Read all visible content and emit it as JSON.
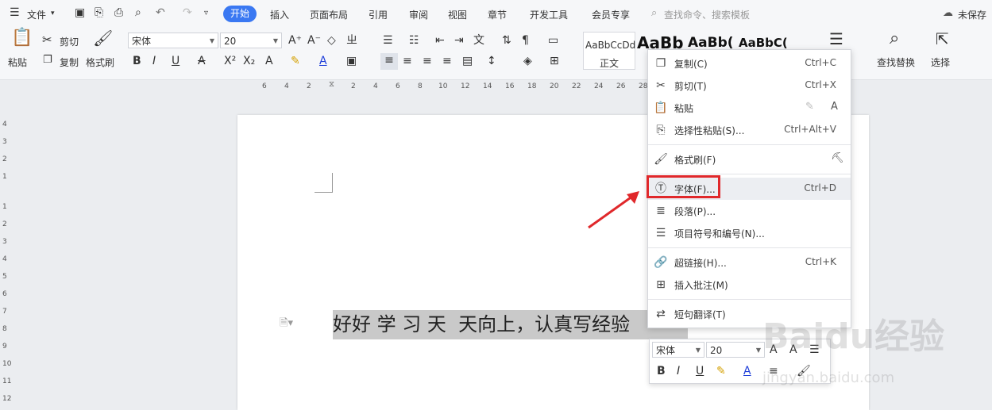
{
  "title_bar": {
    "file_menu": "文件",
    "tabs": [
      "开始",
      "插入",
      "页面布局",
      "引用",
      "审阅",
      "视图",
      "章节",
      "开发工具",
      "会员专享"
    ],
    "active_tab": "开始",
    "search_placeholder": "查找命令、搜索模板",
    "save_status": "未保存"
  },
  "ribbon": {
    "paste": "粘贴",
    "cut": "剪切",
    "copy": "复制",
    "format_painter": "格式刷",
    "font_name": "宋体",
    "font_size": "20",
    "styles": [
      "AaBbCcDd",
      "AaBb",
      "AaBb(",
      "AaBbC("
    ],
    "style_normal_label": "正文",
    "find_replace": "查找替换",
    "select": "选择",
    "accent_color": "#3a78f2"
  },
  "ruler": {
    "numbers": [
      "6",
      "4",
      "2",
      "2",
      "4",
      "6",
      "8",
      "10",
      "12",
      "14",
      "16",
      "18",
      "20",
      "22",
      "24",
      "26",
      "28"
    ],
    "vertical_numbers": [
      "4",
      "3",
      "2",
      "1",
      "1",
      "2",
      "3",
      "4",
      "5",
      "6",
      "7",
      "8",
      "9",
      "10",
      "11",
      "12"
    ]
  },
  "document": {
    "text": "好好 学 习 天  天向上，认真写经验"
  },
  "context_menu": {
    "items": [
      {
        "icon": "copy-icon",
        "label": "复制(C)",
        "shortcut": "Ctrl+C"
      },
      {
        "icon": "cut-icon",
        "label": "剪切(T)",
        "shortcut": "Ctrl+X"
      },
      {
        "icon": "paste-icon",
        "label": "粘贴",
        "shortcut": ""
      },
      {
        "icon": "paste-special-icon",
        "label": "选择性粘贴(S)...",
        "shortcut": "Ctrl+Alt+V"
      },
      {
        "icon": "format-painter-icon",
        "label": "格式刷(F)",
        "shortcut": ""
      },
      {
        "icon": "font-icon",
        "label": "字体(F)...",
        "shortcut": "Ctrl+D"
      },
      {
        "icon": "paragraph-icon",
        "label": "段落(P)...",
        "shortcut": ""
      },
      {
        "icon": "bullets-icon",
        "label": "项目符号和编号(N)...",
        "shortcut": ""
      },
      {
        "icon": "hyperlink-icon",
        "label": "超链接(H)...",
        "shortcut": "Ctrl+K"
      },
      {
        "icon": "comment-icon",
        "label": "插入批注(M)",
        "shortcut": ""
      },
      {
        "icon": "translate-icon",
        "label": "短句翻译(T)",
        "shortcut": ""
      }
    ],
    "highlight_color": "#e0282b"
  },
  "mini_toolbar": {
    "font_name": "宋体",
    "font_size": "20"
  },
  "watermark": {
    "brand": "Baidu经验",
    "url": "jingyan.baidu.com"
  }
}
